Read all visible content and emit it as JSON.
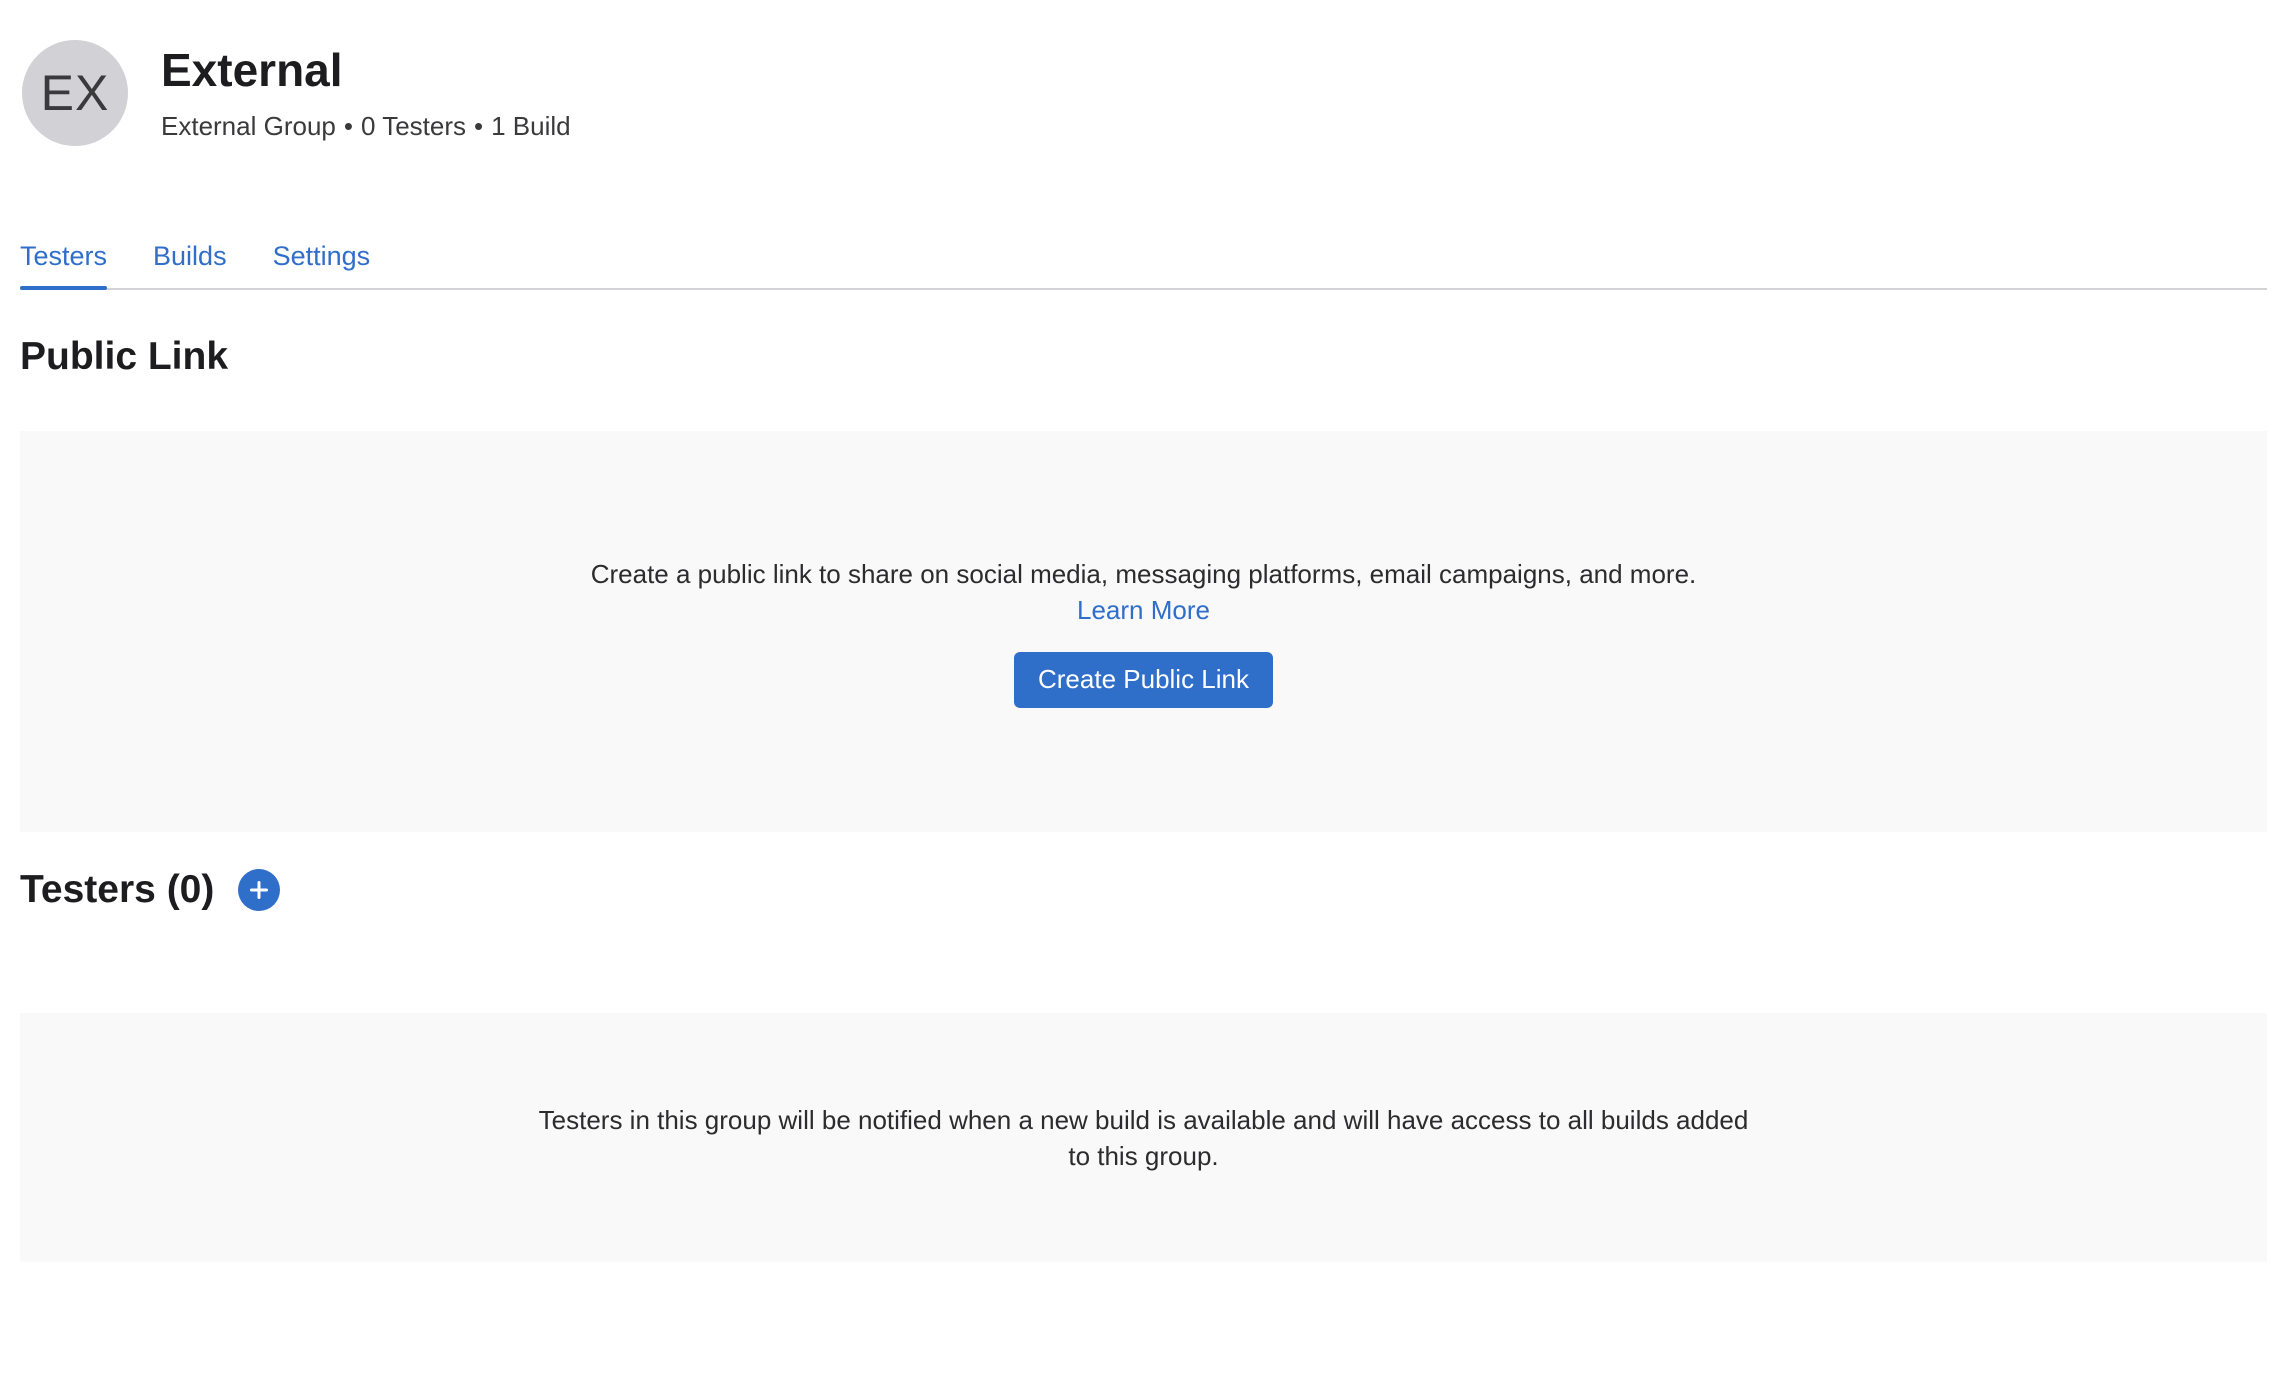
{
  "header": {
    "avatar_initials": "EX",
    "title": "External",
    "subtitle": {
      "group_type": "External Group",
      "separator": "•",
      "testers_count": "0 Testers",
      "builds_count": "1 Build"
    }
  },
  "tabs": [
    {
      "label": "Testers",
      "active": true
    },
    {
      "label": "Builds",
      "active": false
    },
    {
      "label": "Settings",
      "active": false
    }
  ],
  "public_link": {
    "title": "Public Link",
    "description": "Create a public link to share on social media, messaging platforms, email campaigns, and more.",
    "learn_more_label": "Learn More",
    "create_button_label": "Create Public Link"
  },
  "testers": {
    "title": "Testers (0)",
    "add_icon": "plus-circle-icon",
    "empty_message": "Testers in this group will be notified when a new build is available and will have access to all builds added to this group."
  },
  "colors": {
    "accent": "#2f6ec9",
    "avatar_bg": "#d1d1d6",
    "panel_bg": "#f9f9f9",
    "divider": "#d2d2d7"
  }
}
